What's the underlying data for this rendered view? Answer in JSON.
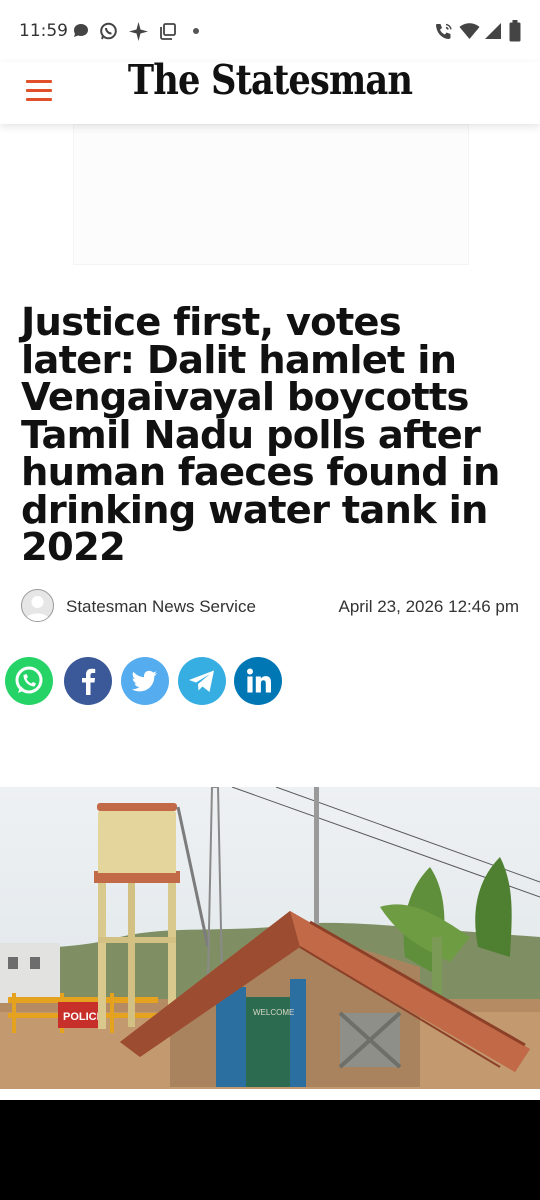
{
  "status_bar": {
    "time": "11:59",
    "icons": [
      "chat-icon",
      "whatsapp-icon",
      "sparkle-icon",
      "copy-icon",
      "dot-icon",
      "wifi-calling-icon",
      "wifi-icon",
      "signal-icon",
      "battery-icon"
    ]
  },
  "header": {
    "logo": "The Statesman",
    "menu_icon": "hamburger-menu-icon",
    "accent_color": "#e0502a"
  },
  "article": {
    "headline": "Justice first, votes later: Dalit hamlet in Vengaivayal boycotts Tamil Nadu polls after human faeces found in drinking water tank in 2022",
    "author": "Statesman News Service",
    "date": "April 23, 2026 12:46 pm",
    "hero_image_sign": "POLICE"
  },
  "share": [
    {
      "icon": "whatsapp-icon",
      "color": "#25d366"
    },
    {
      "icon": "facebook-icon",
      "color": "#3b5998"
    },
    {
      "icon": "twitter-icon",
      "color": "#55acee"
    },
    {
      "icon": "telegram-icon",
      "color": "#37aee2"
    },
    {
      "icon": "linkedin-icon",
      "color": "#0077b5"
    }
  ]
}
